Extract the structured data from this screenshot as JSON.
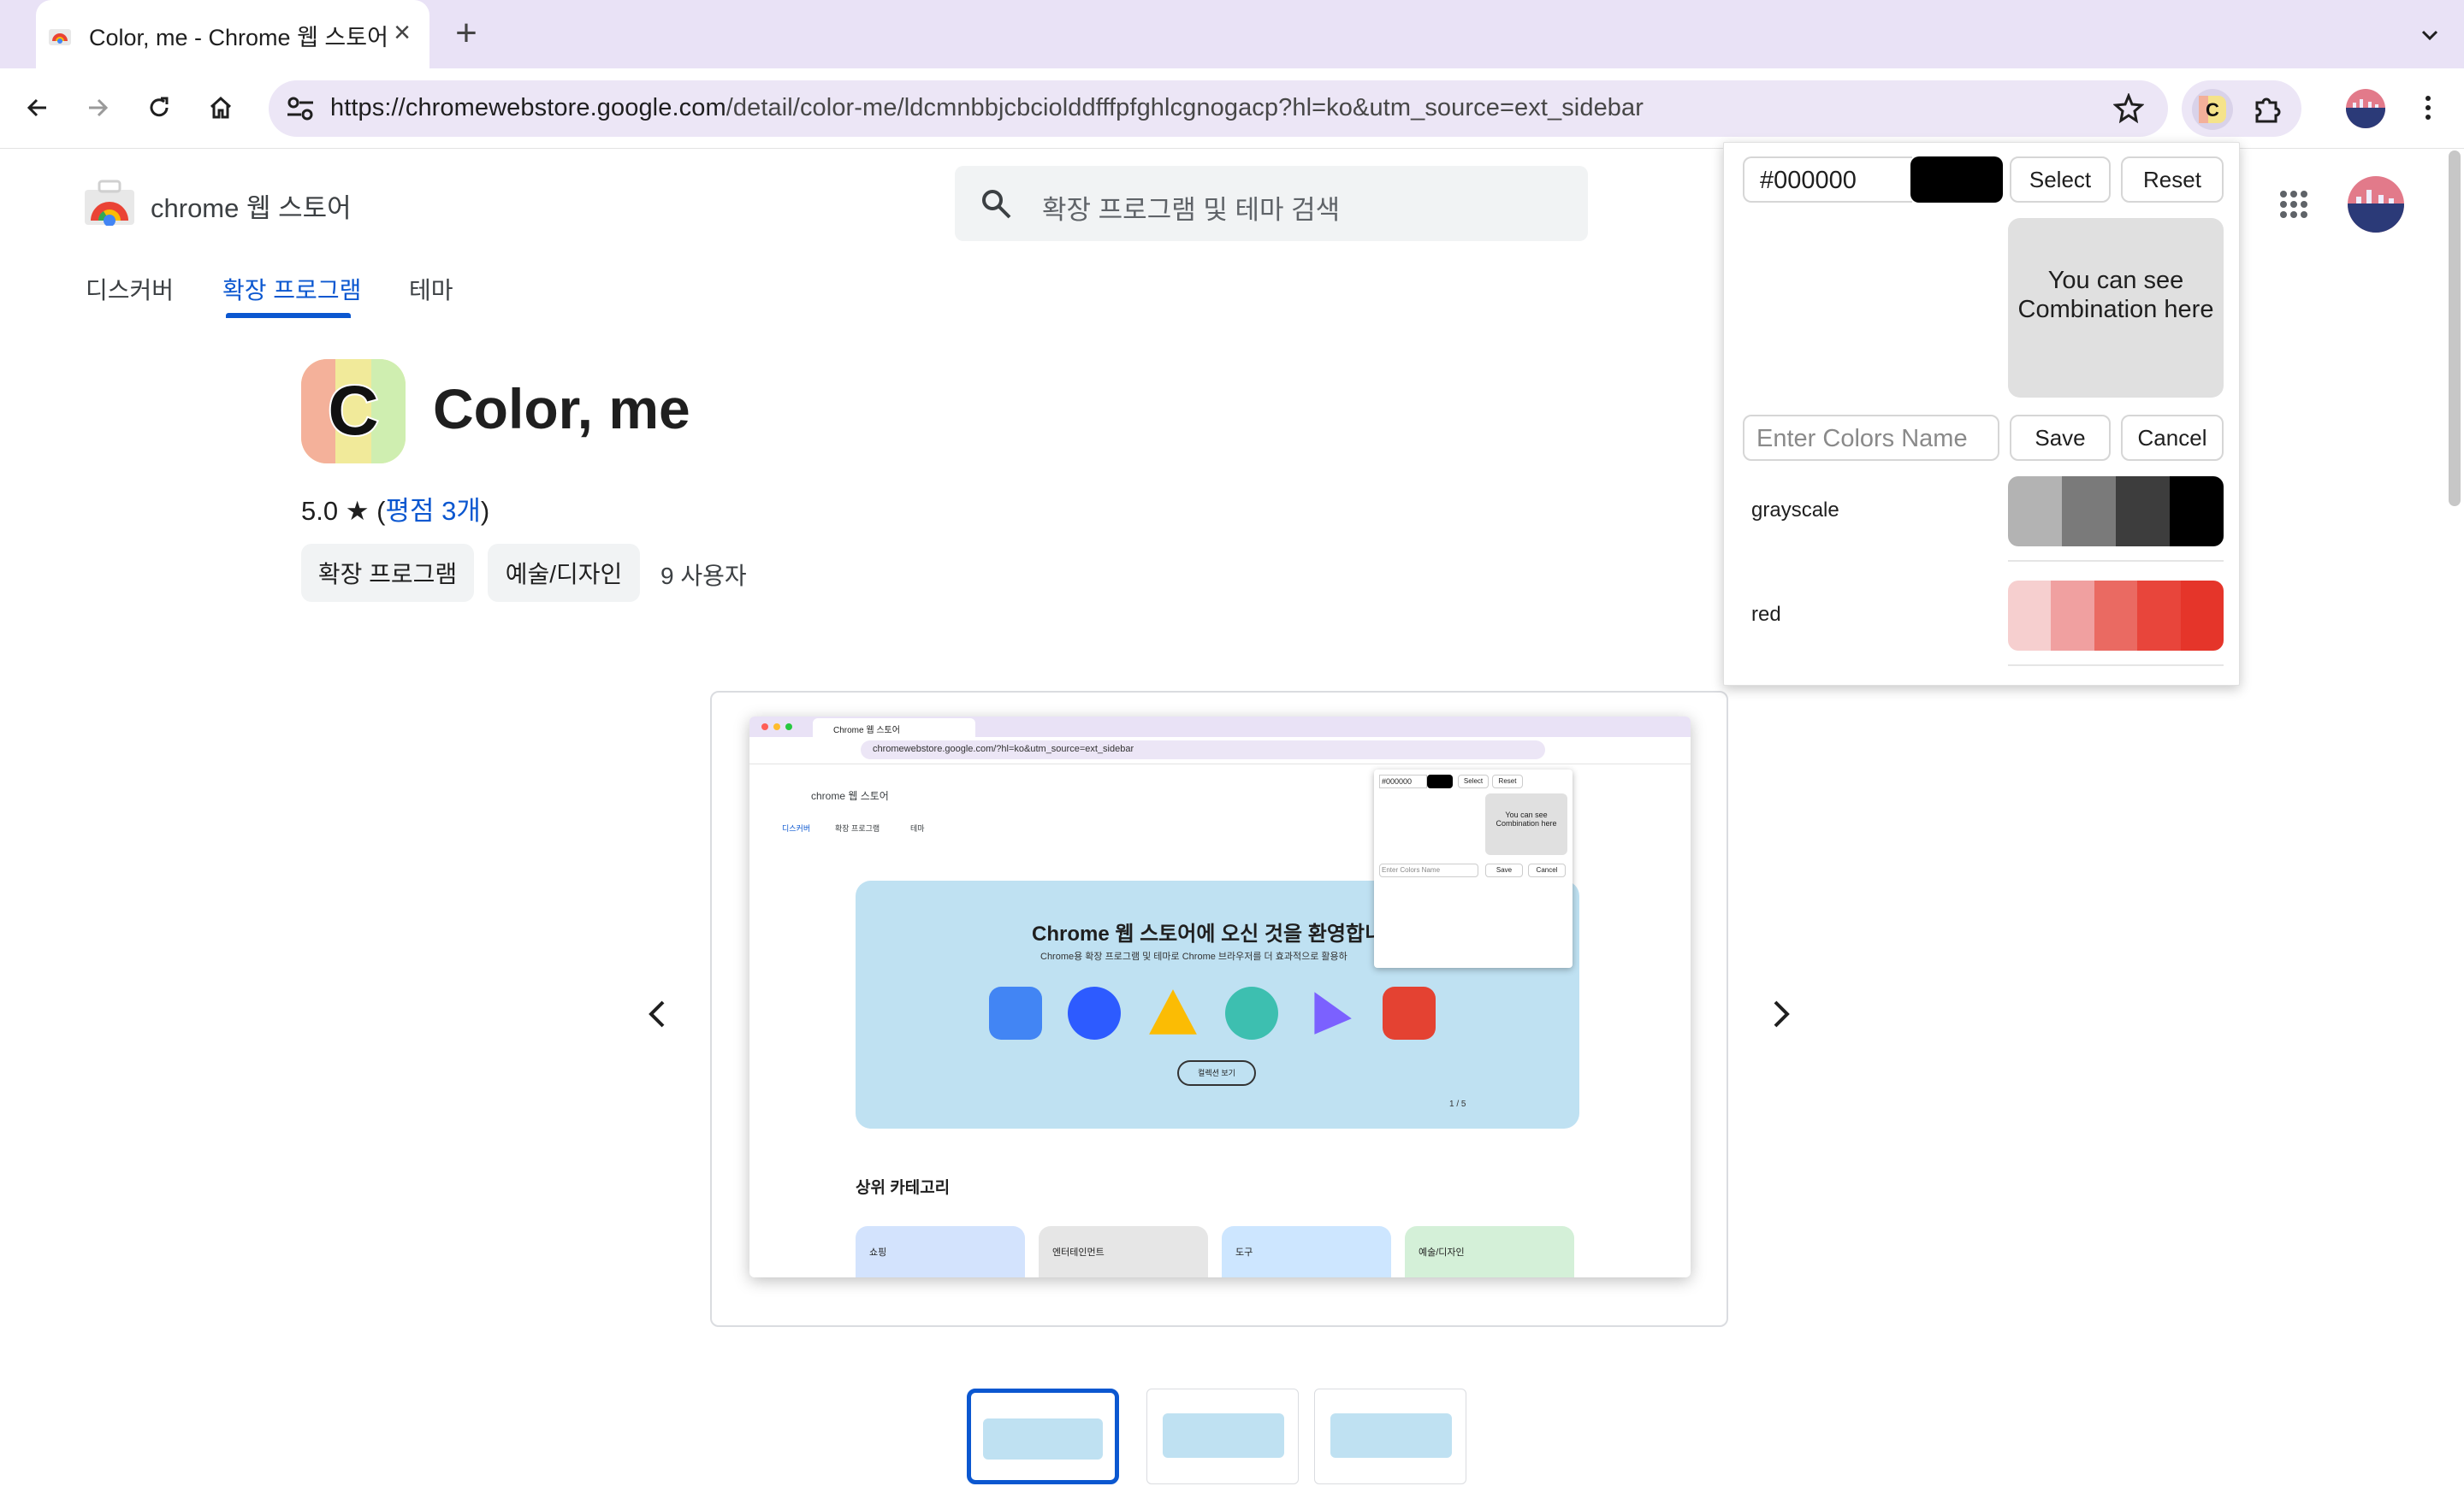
{
  "browser": {
    "tab_title": "Color, me - Chrome 웹 스토어",
    "new_tab": "+",
    "url_prefix": "https://chromewebstore.google.com",
    "url_rest": "/detail/color-me/ldcmnbbjcbcioldd fffpfghlcgnogacp?hl=ko&utm_source=ext_sidebar"
  },
  "store": {
    "name": "chrome 웹 스토어",
    "search_placeholder": "확장 프로그램 및 테마 검색",
    "nav": [
      {
        "label": "디스커버"
      },
      {
        "label": "확장 프로그램"
      },
      {
        "label": "테마"
      }
    ]
  },
  "extension": {
    "title": "Color, me",
    "rating_value": "5.0",
    "rating_star": "★",
    "rating_link": "평점 3개",
    "chips": [
      "확장 프로그램",
      "예술/디자인"
    ],
    "users": "9 사용자"
  },
  "screenshot": {
    "tab_title": "Chrome 웹 스토어",
    "url": "chromewebstore.google.com/?hl=ko&utm_source=ext_sidebar",
    "store_name": "chrome 웹 스토어",
    "nav": [
      "디스커버",
      "확장 프로그램",
      "테마"
    ],
    "hero_title": "Chrome 웹 스토어에 오신 것을 환영합니",
    "hero_sub": "Chrome용 확장 프로그램 및 테마로 Chrome 브라우저를 더 효과적으로 활용하",
    "hero_button": "컬렉션 보기",
    "pager": "1 / 5",
    "category_title": "상위 카테고리",
    "categories": [
      "쇼핑",
      "엔터테인먼트",
      "도구",
      "예술/디자인"
    ],
    "popup_hex": "#000000",
    "popup_select": "Select",
    "popup_reset": "Reset",
    "popup_preview": "You can see Combination here",
    "popup_name_placeholder": "Enter Colors Name",
    "popup_save": "Save",
    "popup_cancel": "Cancel"
  },
  "popup": {
    "hex_value": "#000000",
    "swatch_color": "#000000",
    "select_label": "Select",
    "reset_label": "Reset",
    "preview_text": "You can see Combination here",
    "name_placeholder": "Enter Colors Name",
    "save_label": "Save",
    "cancel_label": "Cancel",
    "palettes": [
      {
        "name": "grayscale",
        "colors": [
          "#b3b3b3",
          "#7a7a7a",
          "#3d3d3d",
          "#000000"
        ]
      },
      {
        "name": "red",
        "colors": [
          "#f6cfcf",
          "#f0a0a0",
          "#ea6a62",
          "#e8453b",
          "#e5352a"
        ]
      }
    ]
  },
  "icons": {
    "back": "arrow-left-icon",
    "forward": "arrow-right-icon",
    "reload": "reload-icon",
    "home": "home-icon",
    "site_info": "tune-icon",
    "bookmark": "star-outline-icon",
    "extension": "color-me-extension-icon",
    "extensions_menu": "puzzle-icon",
    "menu": "more-vert-icon",
    "apps": "apps-grid-icon",
    "search": "search-icon",
    "prev": "chevron-left-icon",
    "next": "chevron-right-icon"
  },
  "colors": {
    "accent": "#0b57d0",
    "tabstrip": "#e9e2f6",
    "omnibox": "#ece6f6"
  }
}
